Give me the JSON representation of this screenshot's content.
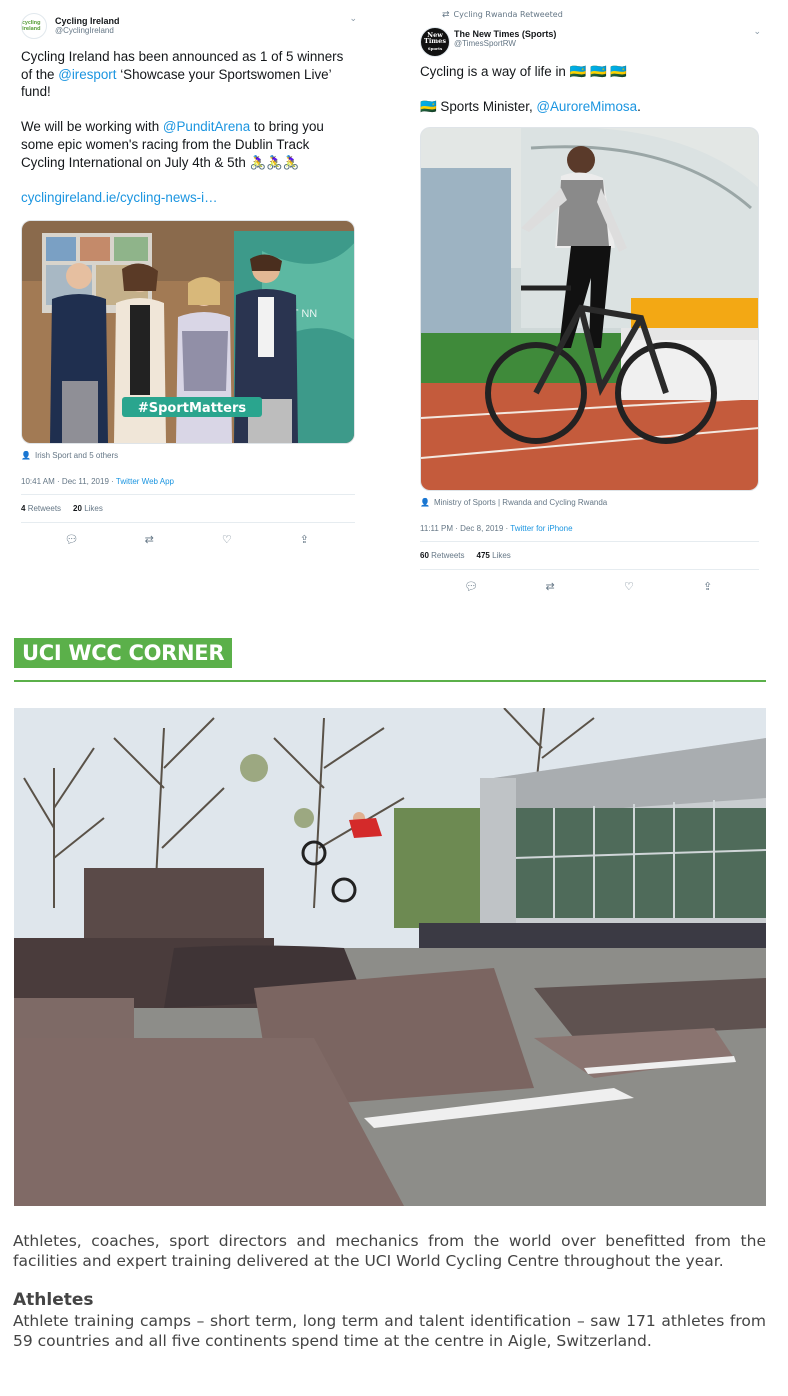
{
  "tweet_left": {
    "name": "Cycling Ireland",
    "handle": "@CyclingIreland",
    "avatar_text": "cycling ireland",
    "text_1_a": "Cycling Ireland has been announced as 1 of 5 winners of the ",
    "text_1_link": "@iresport",
    "text_1_b": " ‘Showcase your Sportswomen Live’ fund!",
    "text_2_a": "We will be working with ",
    "text_2_link": "@PunditArena",
    "text_2_b": " to bring you some epic women's racing from the Dublin Track Cycling International on July 4th & 5th 🚴‍♀️🚴‍♀️🚴‍♀️",
    "link": "cyclingireland.ie/cycling-news-i…",
    "image_banner": "#SportMatters",
    "image_sign": "RT NN",
    "tagged": "Irish Sport and 5 others",
    "time": "10:41 AM · Dec 11, 2019 · ",
    "source": "Twitter Web App",
    "retweets_count": "4",
    "retweets_label": "Retweets",
    "likes_count": "20",
    "likes_label": "Likes"
  },
  "tweet_right": {
    "retweeted_by": "Cycling Rwanda Retweeted",
    "name": "The New Times (Sports)",
    "handle": "@TimesSportRW",
    "avatar_text_1": "New",
    "avatar_text_2": "Times",
    "avatar_text_3": "Sports",
    "text_1": "Cycling is a way of life in 🇷🇼 🇷🇼 🇷🇼",
    "text_2_a": "🇷🇼 Sports Minister, ",
    "text_2_link": "@AuroreMimosa",
    "text_2_b": ".",
    "tagged": "Ministry of Sports | Rwanda and Cycling Rwanda",
    "time": "11:11 PM · Dec 8, 2019 · ",
    "source": "Twitter for iPhone",
    "retweets_count": "60",
    "retweets_label": "Retweets",
    "likes_count": "475",
    "likes_label": "Likes"
  },
  "icons": {
    "reply": "reply-icon",
    "retweet": "retweet-icon",
    "like": "heart-icon",
    "share": "share-icon",
    "caret": "chevron-down-icon",
    "person": "person-icon"
  },
  "section": {
    "title": "UCI WCC CORNER",
    "paragraph_1": "Athletes, coaches, sport directors and mechanics from the world over benefitted from the facilities and expert training delivered at the UCI World Cycling Centre throughout the year.",
    "heading_athletes": "Athletes",
    "paragraph_2": "Athlete training camps – short term, long term and talent identification – saw 171 athletes from 59 countries and all five continents spend time at the centre in Aigle, Switzerland."
  },
  "colors": {
    "accent_green": "#5bb04a",
    "twitter_blue": "#1b95e0",
    "muted": "#657786"
  }
}
